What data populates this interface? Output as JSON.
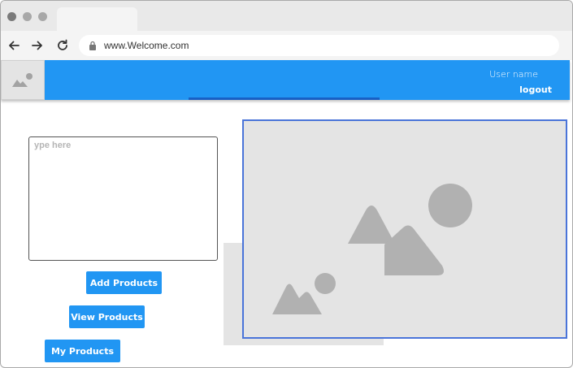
{
  "browser": {
    "url": "www.Welcome.com",
    "icons": [
      "back-arrow-icon",
      "forward-arrow-icon",
      "reload-icon",
      "lock-icon"
    ]
  },
  "header": {
    "logo_icon": "image-placeholder-icon",
    "username": "User name",
    "logout_label": "logout",
    "bg_color": "#2196f3"
  },
  "form": {
    "textarea_placeholder": "ype here",
    "textarea_value": ""
  },
  "buttons": {
    "add_products": "Add Products",
    "view_products": "View Products",
    "my_products": "My Products"
  },
  "image_panel": {
    "icon": "image-placeholder-icon",
    "border_color": "#4a74d9"
  }
}
